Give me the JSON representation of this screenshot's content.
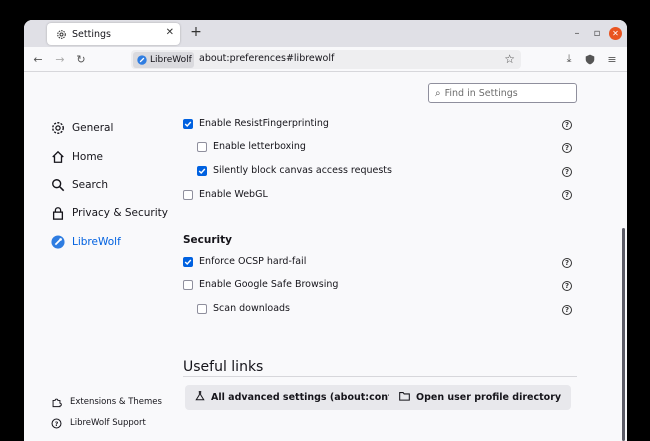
{
  "tabs": [
    {
      "label": "Settings"
    }
  ],
  "url": {
    "badge": "LibreWolf",
    "text": "about:preferences#librewolf"
  },
  "search": {
    "placeholder": "Find in Settings"
  },
  "sidebar": {
    "items": [
      {
        "label": "General"
      },
      {
        "label": "Home"
      },
      {
        "label": "Search"
      },
      {
        "label": "Privacy & Security"
      },
      {
        "label": "LibreWolf"
      }
    ],
    "footer": [
      {
        "label": "Extensions & Themes"
      },
      {
        "label": "LibreWolf Support"
      }
    ]
  },
  "fingerprinting": {
    "items": [
      {
        "label": "Enable ResistFingerprinting",
        "checked": true
      },
      {
        "label": "Enable letterboxing",
        "checked": false
      },
      {
        "label": "Silently block canvas access requests",
        "checked": true
      },
      {
        "label": "Enable WebGL",
        "checked": false
      }
    ]
  },
  "security": {
    "title": "Security",
    "items": [
      {
        "label": "Enforce OCSP hard-fail",
        "checked": true
      },
      {
        "label": "Enable Google Safe Browsing",
        "checked": false
      },
      {
        "label": "Scan downloads",
        "checked": false
      }
    ]
  },
  "useful_links": {
    "title": "Useful links",
    "buttons": [
      {
        "label": "All advanced settings (about:config)"
      },
      {
        "label": "Open user profile directory"
      }
    ]
  },
  "colors": {
    "accent": "#0061e0",
    "close": "#e95420"
  }
}
